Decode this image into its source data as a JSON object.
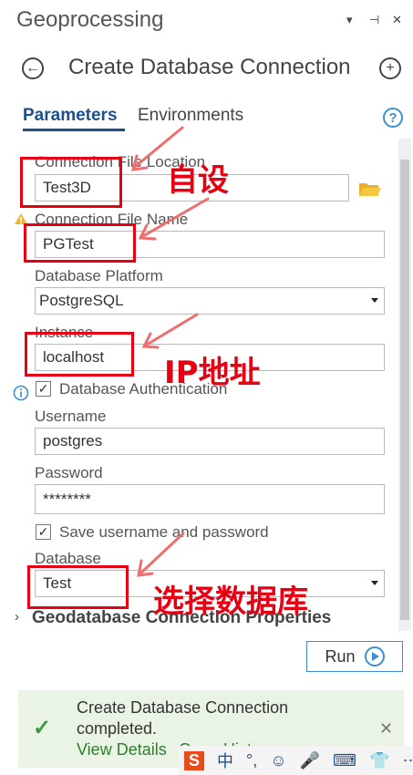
{
  "pane": {
    "title": "Geoprocessing",
    "controls": [
      "▾",
      "⊣",
      "✕"
    ]
  },
  "tool": {
    "title": "Create Database Connection",
    "back_icon": "←",
    "add_icon": "+"
  },
  "tabs": {
    "parameters": "Parameters",
    "environments": "Environments",
    "help_icon": "?"
  },
  "form": {
    "connection_file_location": {
      "label": "Connection File Location",
      "value": "Test3D"
    },
    "connection_file_name": {
      "label": "Connection File Name",
      "value": "PGTest"
    },
    "database_platform": {
      "label": "Database Platform",
      "value": "PostgreSQL"
    },
    "instance": {
      "label": "Instance",
      "value": "localhost"
    },
    "database_authentication": {
      "label": "Database Authentication",
      "checked": "✓"
    },
    "username": {
      "label": "Username",
      "value": "postgres"
    },
    "password": {
      "label": "Password",
      "value": "********"
    },
    "save_credentials": {
      "label": "Save username and password",
      "checked": "✓"
    },
    "database": {
      "label": "Database",
      "value": "Test"
    },
    "gdb_section": "Geodatabase Connection Properties"
  },
  "annotations": {
    "custom": "自设",
    "ip_address": "IP地址",
    "choose_db": "选择数据库"
  },
  "actions": {
    "run_label": "Run"
  },
  "notice": {
    "line1": "Create Database Connection",
    "line2": "completed.",
    "view_details": "View Details",
    "open_history": "Open History",
    "check_icon": "✓",
    "close_icon": "✕"
  },
  "ime": {
    "items": [
      "S",
      "中",
      "°,",
      "☺",
      "🎤",
      "⌨",
      "👕",
      "⋯"
    ]
  },
  "colors": {
    "accent": "#1e4f8c",
    "link_blue": "#3f8fd2",
    "annotation_red": "#e60012",
    "notice_bg": "#eaf4e4"
  }
}
